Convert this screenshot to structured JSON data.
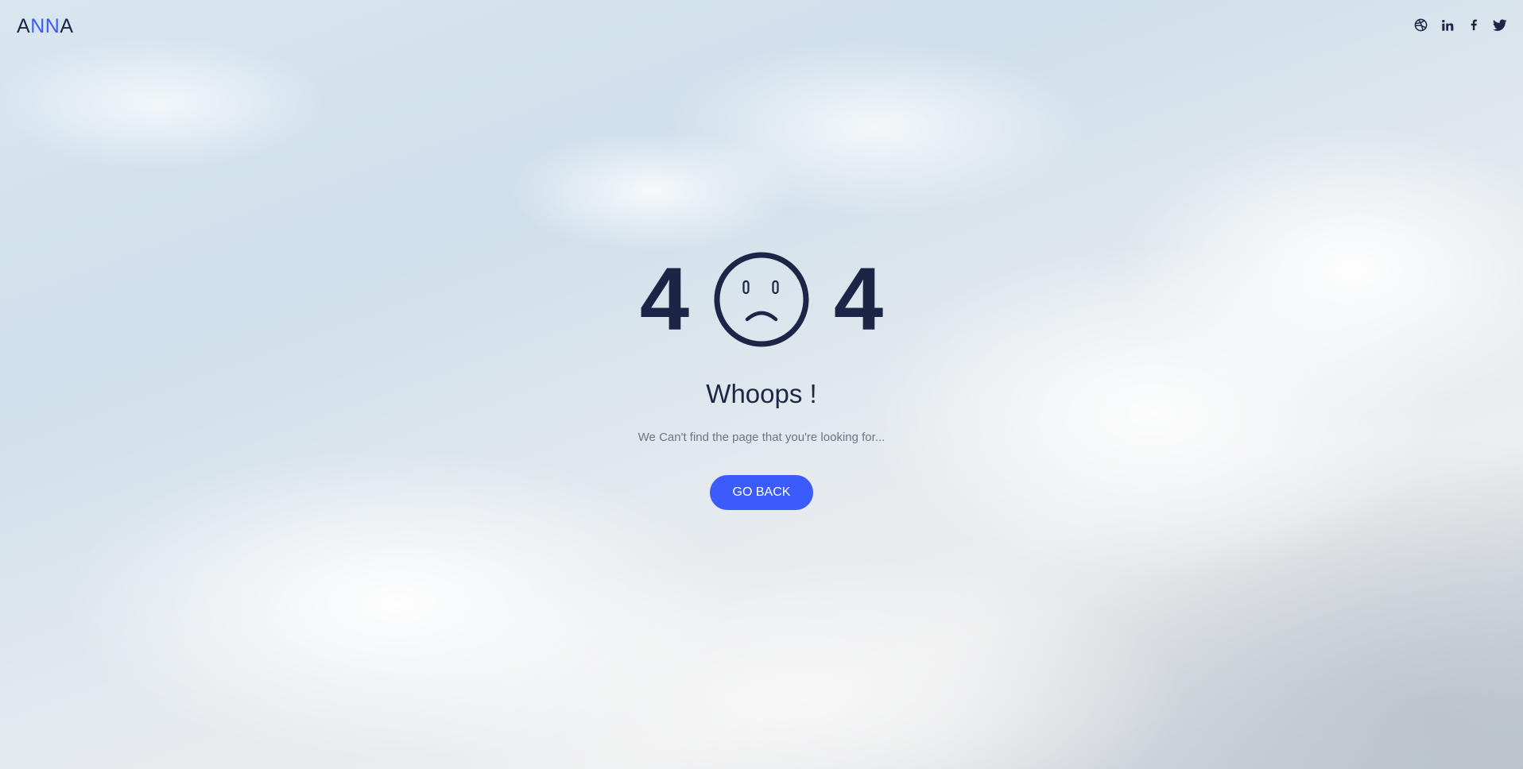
{
  "brand": {
    "letters": [
      "A",
      "N",
      "N",
      "A"
    ],
    "colors": [
      "#1d2547",
      "#3b5bfd",
      "#3b5bfd",
      "#1d2547"
    ]
  },
  "social": [
    {
      "name": "dribbble-icon"
    },
    {
      "name": "linkedin-icon"
    },
    {
      "name": "facebook-icon"
    },
    {
      "name": "twitter-icon"
    }
  ],
  "error": {
    "digit_left": "4",
    "digit_right": "4",
    "title": "Whoops !",
    "message": "We Can't find the page that you're looking for...",
    "button_label": "GO BACK"
  },
  "colors": {
    "text_dark": "#1d2547",
    "accent": "#3b5bfd",
    "muted": "#6b7488"
  }
}
